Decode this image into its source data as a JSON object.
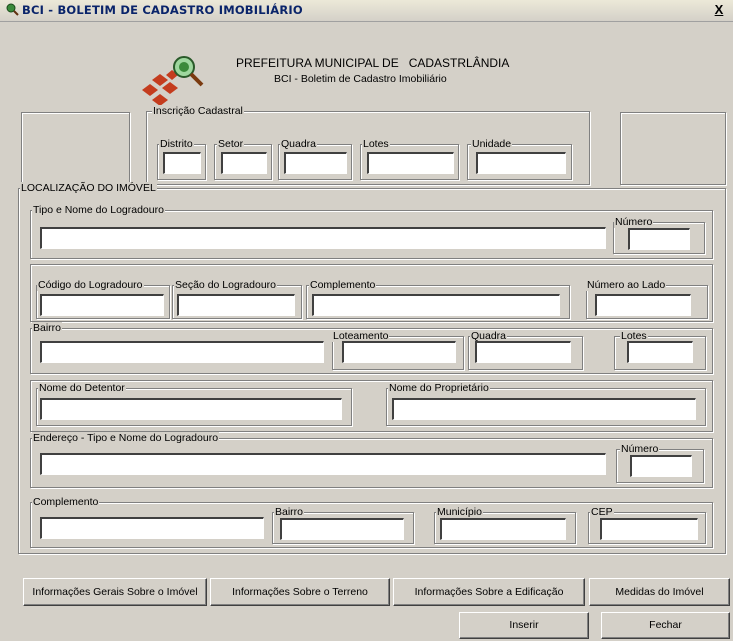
{
  "window": {
    "title": "BCI - BOLETIM DE CADASTRO IMOBILIÁRIO",
    "close_label": "X"
  },
  "header": {
    "line1": "PREFEITURA MUNICIPAL DE   CADASTRLÂNDIA",
    "line2": "BCI - Boletim de Cadastro Imobiliário"
  },
  "inscricao": {
    "title": "Inscrição Cadastral",
    "distrito": "Distrito",
    "setor": "Setor",
    "quadra": "Quadra",
    "lotes": "Lotes",
    "unidade": "Unidade"
  },
  "localizacao": {
    "title": "LOCALIZAÇÃO DO IMÓVEL",
    "tipo_nome_logradouro": "Tipo e Nome do Logradouro",
    "numero": "Número",
    "codigo_logradouro": "Código do Logradouro",
    "secao_logradouro": "Seção do Logradouro",
    "complemento": "Complemento",
    "numero_ao_lado": "Número ao Lado",
    "bairro": "Bairro",
    "loteamento": "Loteamento",
    "quadra": "Quadra",
    "lotes": "Lotes",
    "nome_detentor": "Nome do Detentor",
    "nome_proprietario": "Nome do Proprietário",
    "endereco_tipo_nome": "Endereço - Tipo e Nome do Logradouro",
    "numero2": "Número",
    "complemento2": "Complemento",
    "bairro2": "Bairro",
    "municipio": "Município",
    "cep": "CEP"
  },
  "buttons": {
    "info_gerais": "Informações Gerais Sobre o Imóvel",
    "info_terreno": "Informações Sobre o Terreno",
    "info_edificacao": "Informações Sobre a Edificação",
    "medidas": "Medidas do Imóvel",
    "inserir": "Inserir",
    "fechar": "Fechar"
  }
}
